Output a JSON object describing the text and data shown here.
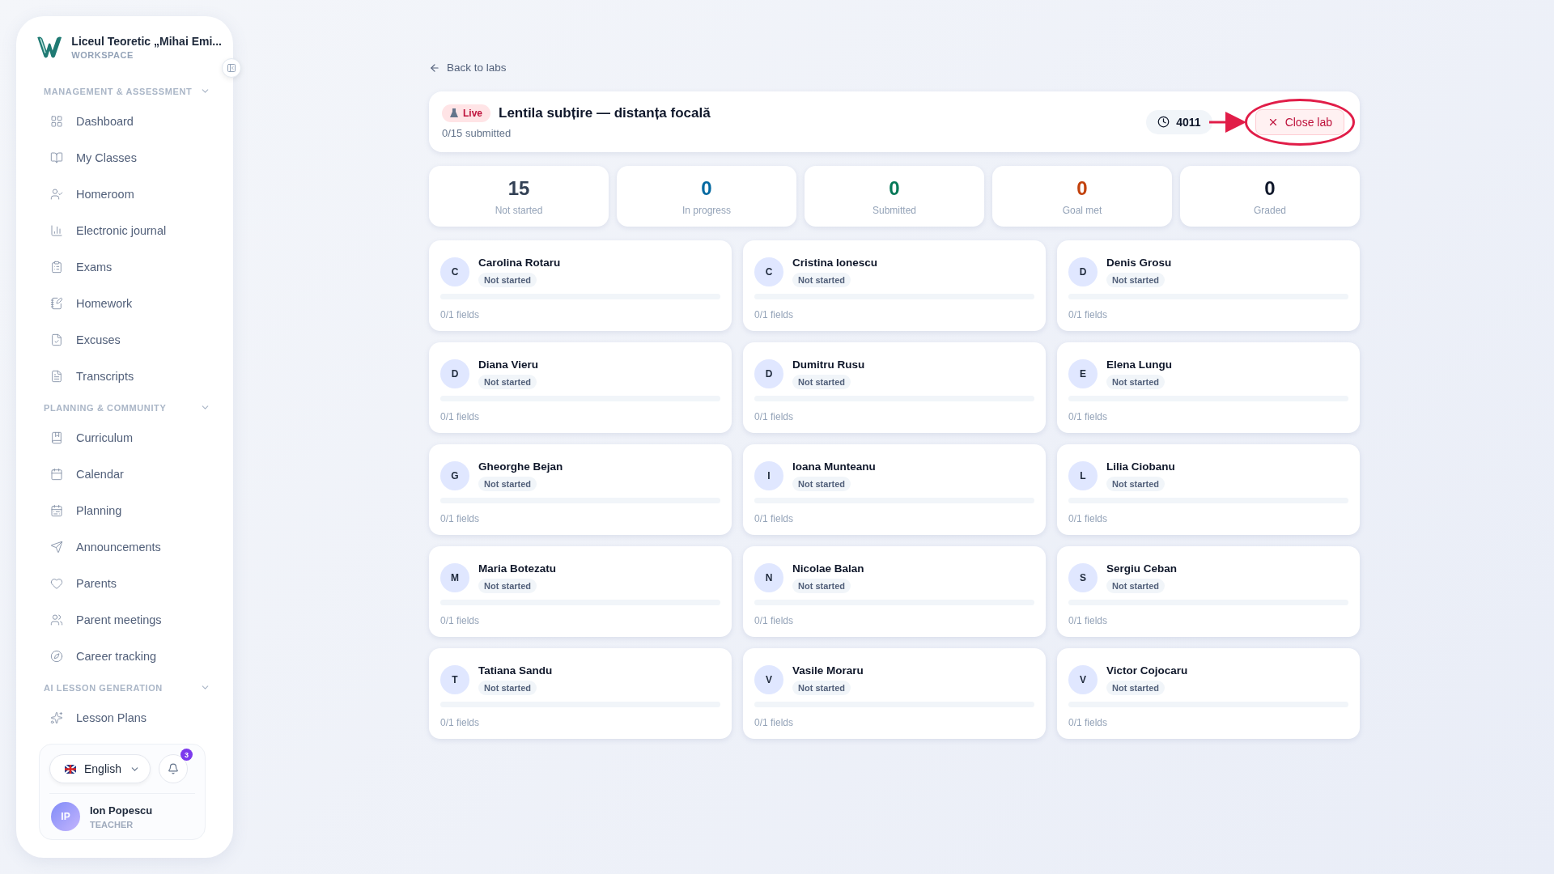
{
  "sidebar": {
    "school": "Liceul Teoretic „Mihai Emi...",
    "workspace": "WORKSPACE",
    "sections": [
      {
        "title": "MANAGEMENT & ASSESSMENT",
        "expanded": true,
        "items": [
          {
            "label": "Dashboard"
          },
          {
            "label": "My Classes"
          },
          {
            "label": "Homeroom"
          },
          {
            "label": "Electronic journal"
          },
          {
            "label": "Exams"
          },
          {
            "label": "Homework"
          },
          {
            "label": "Excuses"
          },
          {
            "label": "Transcripts"
          }
        ]
      },
      {
        "title": "PLANNING & COMMUNITY",
        "expanded": true,
        "items": [
          {
            "label": "Curriculum"
          },
          {
            "label": "Calendar"
          },
          {
            "label": "Planning"
          },
          {
            "label": "Announcements"
          },
          {
            "label": "Parents"
          },
          {
            "label": "Parent meetings"
          },
          {
            "label": "Career tracking"
          }
        ]
      },
      {
        "title": "AI LESSON GENERATION",
        "expanded": true,
        "items": [
          {
            "label": "Lesson Plans"
          }
        ]
      }
    ],
    "language": "English",
    "notifications": "3",
    "user": {
      "initials": "IP",
      "name": "Ion Popescu",
      "role": "TEACHER"
    }
  },
  "back_link": "Back to labs",
  "lab": {
    "status": "Live",
    "title": "Lentila subțire — distanța focală",
    "submitted": "0/15 submitted",
    "timer": "4011",
    "close_button": "Close lab"
  },
  "stats": [
    {
      "value": "15",
      "label": "Not started",
      "color": "#334155"
    },
    {
      "value": "0",
      "label": "In progress",
      "color": "#0369a1"
    },
    {
      "value": "0",
      "label": "Submitted",
      "color": "#047857"
    },
    {
      "value": "0",
      "label": "Goal met",
      "color": "#c2410c"
    },
    {
      "value": "0",
      "label": "Graded",
      "color": "#0f172a"
    }
  ],
  "students": [
    {
      "initial": "C",
      "name": "Carolina Rotaru",
      "status": "Not started",
      "level": 0,
      "fields": "0/1 fields"
    },
    {
      "initial": "C",
      "name": "Cristina Ionescu",
      "status": "Not started",
      "level": 0,
      "fields": "0/1 fields"
    },
    {
      "initial": "D",
      "name": "Denis Grosu",
      "status": "Not started",
      "level": 0,
      "fields": "0/1 fields"
    },
    {
      "initial": "D",
      "name": "Diana Vieru",
      "status": "Not started",
      "level": 0,
      "fields": "0/1 fields"
    },
    {
      "initial": "D",
      "name": "Dumitru Rusu",
      "status": "Not started",
      "level": 0,
      "fields": "0/1 fields"
    },
    {
      "initial": "E",
      "name": "Elena Lungu",
      "status": "Not started",
      "level": 0,
      "fields": "0/1 fields"
    },
    {
      "initial": "G",
      "name": "Gheorghe Bejan",
      "status": "Not started",
      "level": 0,
      "fields": "0/1 fields"
    },
    {
      "initial": "I",
      "name": "Ioana Munteanu",
      "status": "Not started",
      "level": 0,
      "fields": "0/1 fields"
    },
    {
      "initial": "L",
      "name": "Lilia Ciobanu",
      "status": "Not started",
      "level": 0,
      "fields": "0/1 fields"
    },
    {
      "initial": "M",
      "name": "Maria Botezatu",
      "status": "Not started",
      "level": 0,
      "fields": "0/1 fields"
    },
    {
      "initial": "N",
      "name": "Nicolae Balan",
      "status": "Not started",
      "level": 0,
      "fields": "0/1 fields"
    },
    {
      "initial": "S",
      "name": "Sergiu Ceban",
      "status": "Not started",
      "level": 0,
      "fields": "0/1 fields"
    },
    {
      "initial": "T",
      "name": "Tatiana Sandu",
      "status": "Not started",
      "level": 0,
      "fields": "0/1 fields"
    },
    {
      "initial": "V",
      "name": "Vasile Moraru",
      "status": "Not started",
      "level": 0,
      "fields": "0/1 fields"
    },
    {
      "initial": "V",
      "name": "Victor Cojocaru",
      "status": "Not started",
      "level": 0,
      "fields": "0/1 fields"
    }
  ]
}
